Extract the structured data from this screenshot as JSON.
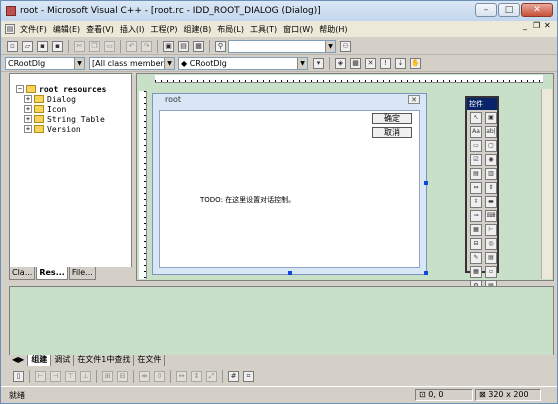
{
  "window": {
    "title": "root - Microsoft Visual C++ - [root.rc - IDD_ROOT_DIALOG (Dialog)]",
    "minimize": "–",
    "maximize": "□",
    "close": "✕"
  },
  "menubar": {
    "items": [
      "文件(F)",
      "编辑(E)",
      "查看(V)",
      "插入(I)",
      "工程(P)",
      "组建(B)",
      "布局(L)",
      "工具(T)",
      "窗口(W)",
      "帮助(H)"
    ],
    "doc_controls": [
      "_",
      "❐",
      "✕"
    ]
  },
  "toolbar1": {
    "find_combo": ""
  },
  "toolbar2": {
    "class_combo": "CRootDlg",
    "members_combo": "[All class members]",
    "function_combo": "CRootDlg"
  },
  "workspace": {
    "tree": {
      "root": "root resources",
      "children": [
        "Dialog",
        "Icon",
        "String Table",
        "Version"
      ]
    },
    "tabs": [
      "Cla...",
      "Res...",
      "File..."
    ],
    "active_tab": "Res..."
  },
  "dialog_editor": {
    "dialog_title": "root",
    "ok_button": "确定",
    "cancel_button": "取消",
    "todo_text": "TODO: 在这里设置对话控制。"
  },
  "controls_palette": {
    "title": "控件",
    "icons": [
      "pointer-icon",
      "picture-icon",
      "static-text-icon",
      "edit-box-icon",
      "group-box-icon",
      "button-icon",
      "check-box-icon",
      "radio-button-icon",
      "combo-box-icon",
      "list-box-icon",
      "horizontal-scrollbar-icon",
      "vertical-scrollbar-icon",
      "spin-icon",
      "progress-icon",
      "slider-icon",
      "hotkey-icon",
      "list-control-icon",
      "tree-control-icon",
      "tab-control-icon",
      "animate-icon",
      "rich-edit-icon",
      "date-time-picker-icon",
      "month-calendar-icon",
      "ip-address-icon",
      "custom-control-icon",
      "extended-combo-icon"
    ]
  },
  "output": {
    "tabs": [
      "组建",
      "调试",
      "在文件1中查找",
      "在文件"
    ],
    "active_tab": "组建"
  },
  "statusbar": {
    "status": "就绪",
    "position": "0, 0",
    "size": "320 x 200"
  },
  "colors": {
    "editor_bg": "#c8dfc8",
    "dialog_frame": "#d8e6f5",
    "palette_title": "#0a246a"
  }
}
